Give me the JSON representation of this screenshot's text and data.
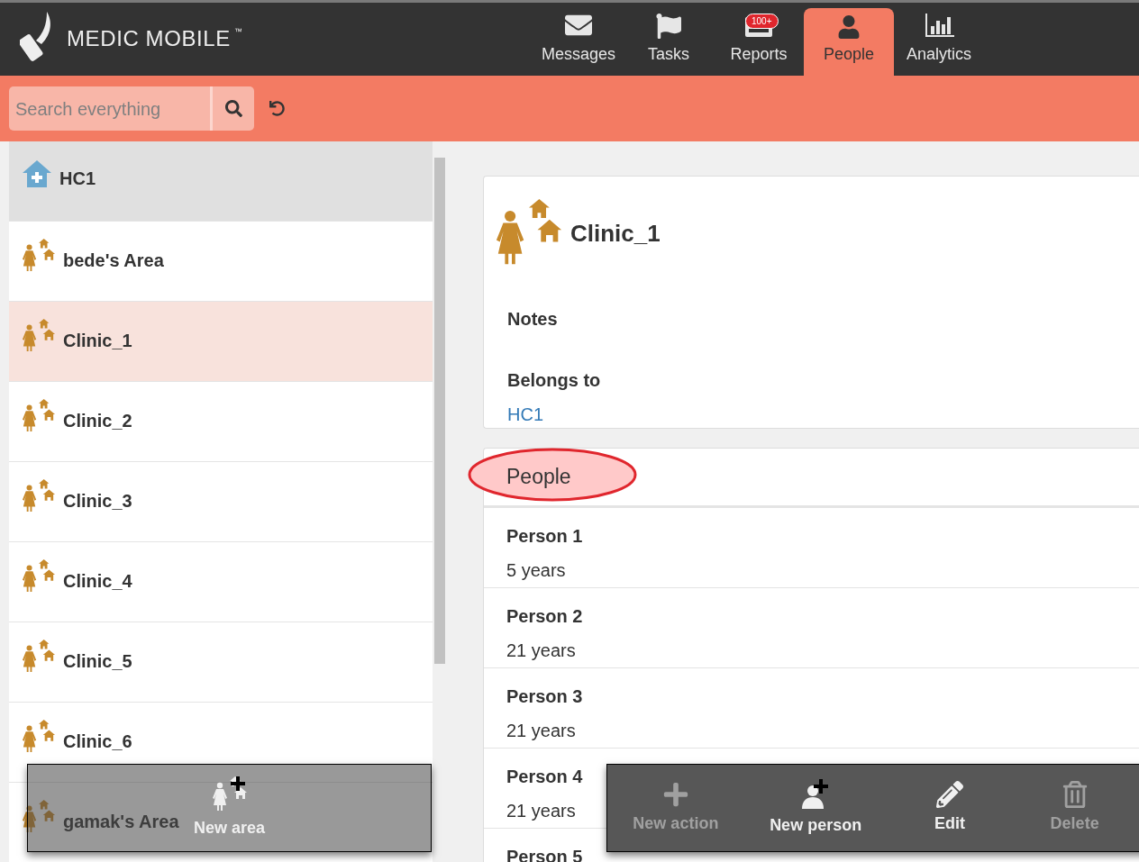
{
  "header": {
    "logo": "MEDIC MOBILE",
    "trademark": "™",
    "tabs": [
      {
        "label": "Messages",
        "kind": "messages",
        "selected": false
      },
      {
        "label": "Tasks",
        "kind": "tasks",
        "selected": false
      },
      {
        "label": "Reports",
        "kind": "reports",
        "selected": false,
        "badge": "100+"
      },
      {
        "label": "People",
        "kind": "people",
        "selected": true
      },
      {
        "label": "Analytics",
        "kind": "analytics",
        "selected": false
      }
    ]
  },
  "search": {
    "placeholder": "Search everything"
  },
  "contacts": [
    {
      "name": "HC1",
      "kind": "health_center",
      "selected": false
    },
    {
      "name": "bede's Area",
      "kind": "area",
      "selected": false
    },
    {
      "name": "Clinic_1",
      "kind": "area",
      "selected": true
    },
    {
      "name": "Clinic_2",
      "kind": "area",
      "selected": false
    },
    {
      "name": "Clinic_3",
      "kind": "area",
      "selected": false
    },
    {
      "name": "Clinic_4",
      "kind": "area",
      "selected": false
    },
    {
      "name": "Clinic_5",
      "kind": "area",
      "selected": false
    },
    {
      "name": "Clinic_6",
      "kind": "area",
      "selected": false
    },
    {
      "name": "gamak's Area",
      "kind": "area",
      "selected": false
    }
  ],
  "left_actions": [
    {
      "label": "New area",
      "kind": "add_area",
      "disabled": false
    }
  ],
  "place": {
    "name": "Clinic_1",
    "fields": [
      {
        "label": "Notes"
      },
      {
        "label": "Belongs to",
        "value": "HC1"
      }
    ]
  },
  "people_section": {
    "title": "People",
    "highlighted": true,
    "people": [
      {
        "name": "Person 1",
        "age": "5 years"
      },
      {
        "name": "Person 2",
        "age": "21 years"
      },
      {
        "name": "Person 3",
        "age": "21 years"
      },
      {
        "name": "Person 4",
        "age": "21 years"
      },
      {
        "name": "Person 5"
      }
    ]
  },
  "right_actions": [
    {
      "label": "New action",
      "kind": "add",
      "disabled": true
    },
    {
      "label": "New person",
      "kind": "add_person",
      "disabled": false
    },
    {
      "label": "Edit",
      "kind": "edit",
      "disabled": false
    },
    {
      "label": "Delete",
      "kind": "delete",
      "disabled": true
    }
  ]
}
